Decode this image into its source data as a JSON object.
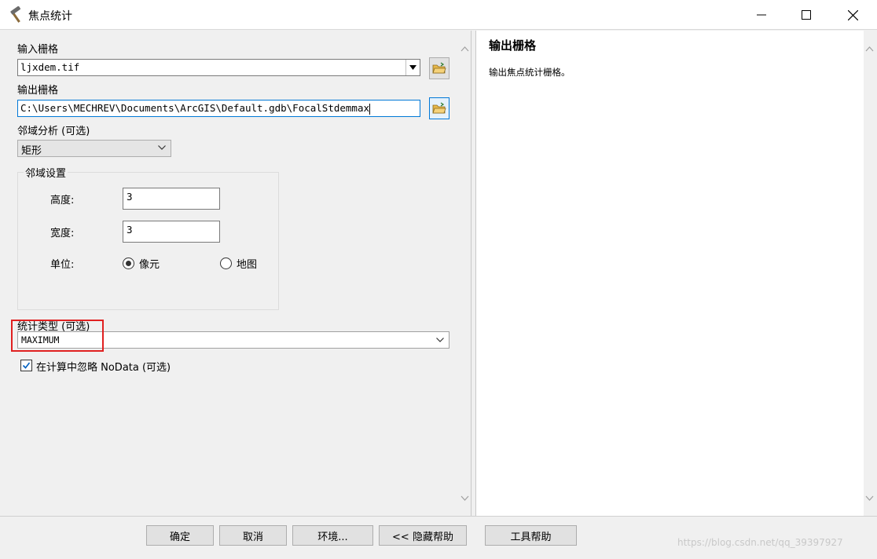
{
  "window": {
    "title": "焦点统计"
  },
  "form": {
    "input_raster": {
      "label": "输入栅格",
      "value": "ljxdem.tif"
    },
    "output_raster": {
      "label": "输出栅格",
      "value": "C:\\Users\\MECHREV\\Documents\\ArcGIS\\Default.gdb\\FocalStdemmax"
    },
    "neighborhood": {
      "label": "邻域分析 (可选)",
      "value": "矩形"
    },
    "neighborhood_settings": {
      "title": "邻域设置",
      "height_label": "高度:",
      "height_value": "3",
      "width_label": "宽度:",
      "width_value": "3",
      "units_label": "单位:",
      "units_option_cell": "像元",
      "units_option_map": "地图",
      "units_selected": "像元"
    },
    "statistics_type": {
      "label": "统计类型 (可选)",
      "value": "MAXIMUM"
    },
    "ignore_nodata": {
      "label": "在计算中忽略 NoData (可选)",
      "checked": true
    }
  },
  "help": {
    "title": "输出栅格",
    "description": "输出焦点统计栅格。"
  },
  "buttons": {
    "ok": "确定",
    "cancel": "取消",
    "environments": "环境...",
    "hide_help": "<< 隐藏帮助",
    "tool_help": "工具帮助"
  },
  "watermark": "https://blog.csdn.net/qq_39397927",
  "colors": {
    "accent": "#0078d7",
    "highlight": "#e02020"
  },
  "icons": {
    "app": "hammer-icon",
    "folder": "open-folder-icon"
  }
}
